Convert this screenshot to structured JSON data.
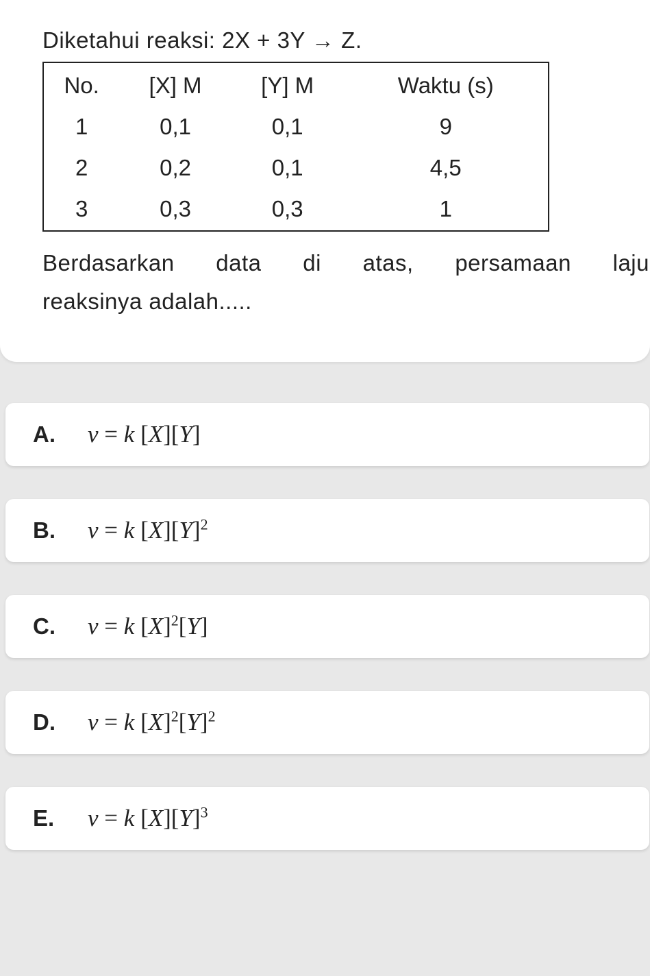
{
  "question": {
    "reaction": "Diketahui reaksi: 2X + 3Y → Z.",
    "table": {
      "headers": [
        "No.",
        "[X] M",
        "[Y] M",
        "Waktu (s)"
      ],
      "rows": [
        [
          "1",
          "0,1",
          "0,1",
          "9"
        ],
        [
          "2",
          "0,2",
          "0,1",
          "4,5"
        ],
        [
          "3",
          "0,3",
          "0,3",
          "1"
        ]
      ]
    },
    "conclusion_words": [
      "Berdasarkan",
      "data",
      "di",
      "atas,",
      "persamaan",
      "laju"
    ],
    "conclusion_line2": "reaksinya adalah....."
  },
  "answers": {
    "A": {
      "label": "A.",
      "formula_html": "<span class='v'>v</span> = <span class='k'>k</span> <span class='br'>[</span><span class='v'>X</span><span class='br'>][</span><span class='v'>Y</span><span class='br'>]</span>"
    },
    "B": {
      "label": "B.",
      "formula_html": "<span class='v'>v</span> = <span class='k'>k</span> <span class='br'>[</span><span class='v'>X</span><span class='br'>][</span><span class='v'>Y</span><span class='br'>]</span><sup>2</sup>"
    },
    "C": {
      "label": "C.",
      "formula_html": "<span class='v'>v</span> = <span class='k'>k</span> <span class='br'>[</span><span class='v'>X</span><span class='br'>]</span><sup>2</sup><span class='br'>[</span><span class='v'>Y</span><span class='br'>]</span>"
    },
    "D": {
      "label": "D.",
      "formula_html": "<span class='v'>v</span> = <span class='k'>k</span> <span class='br'>[</span><span class='v'>X</span><span class='br'>]</span><sup>2</sup><span class='br'>[</span><span class='v'>Y</span><span class='br'>]</span><sup>2</sup>"
    },
    "E": {
      "label": "E.",
      "formula_html": "<span class='v'>v</span> = <span class='k'>k</span> <span class='br'>[</span><span class='v'>X</span><span class='br'>][</span><span class='v'>Y</span><span class='br'>]</span><sup>3</sup>"
    }
  },
  "chart_data": {
    "type": "table",
    "title": "Diketahui reaksi: 2X + 3Y → Z.",
    "headers": [
      "No.",
      "[X] M",
      "[Y] M",
      "Waktu (s)"
    ],
    "rows": [
      {
        "No.": 1,
        "[X] M": 0.1,
        "[Y] M": 0.1,
        "Waktu (s)": 9
      },
      {
        "No.": 2,
        "[X] M": 0.2,
        "[Y] M": 0.1,
        "Waktu (s)": 4.5
      },
      {
        "No.": 3,
        "[X] M": 0.3,
        "[Y] M": 0.3,
        "Waktu (s)": 1
      }
    ]
  }
}
